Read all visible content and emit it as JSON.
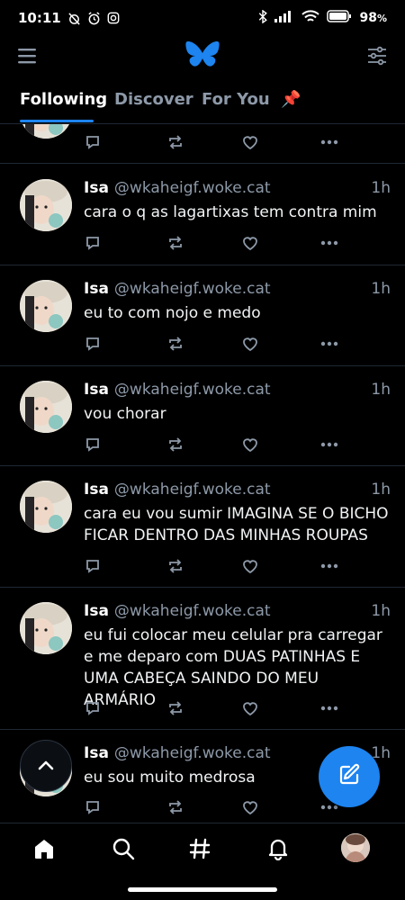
{
  "status_bar": {
    "time": "10:11",
    "battery": "98",
    "battery_unit": "%"
  },
  "header": {
    "logo_icon": "butterfly-icon",
    "menu_icon": "hamburger-menu-icon",
    "feeds_icon": "sliders-icon"
  },
  "tabs": [
    {
      "label": "Following",
      "active": true
    },
    {
      "label": "Discover",
      "active": false
    },
    {
      "label": "For You",
      "active": false
    },
    {
      "label": "📌",
      "active": false
    }
  ],
  "posts": [
    {
      "name": "Isa",
      "handle": "@wkaheigf.woke.cat",
      "time": "1h",
      "text": "cara o q as lagartixas tem contra mim"
    },
    {
      "name": "Isa",
      "handle": "@wkaheigf.woke.cat",
      "time": "1h",
      "text": "eu to com nojo e medo"
    },
    {
      "name": "Isa",
      "handle": "@wkaheigf.woke.cat",
      "time": "1h",
      "text": "vou chorar"
    },
    {
      "name": "Isa",
      "handle": "@wkaheigf.woke.cat",
      "time": "1h",
      "text": "cara eu vou sumir IMAGINA SE O BICHO FICAR DENTRO DAS MINHAS ROUPAS"
    },
    {
      "name": "Isa",
      "handle": "@wkaheigf.woke.cat",
      "time": "1h",
      "text": "eu fui colocar meu celular pra carregar e me deparo com DUAS PATINHAS E UMA CABEÇA SAINDO DO MEU ARMÁRIO"
    },
    {
      "name": "Isa",
      "handle": "@wkaheigf.woke.cat",
      "time": "1h",
      "text": "eu sou muito medrosa"
    }
  ],
  "colors": {
    "accent": "#1d84f0",
    "background": "#000000",
    "muted_text": "#8d99a8",
    "divider": "#1f2833"
  },
  "nav": [
    "home-icon",
    "search-icon",
    "hashtag-icon",
    "bell-icon",
    "profile-avatar"
  ]
}
